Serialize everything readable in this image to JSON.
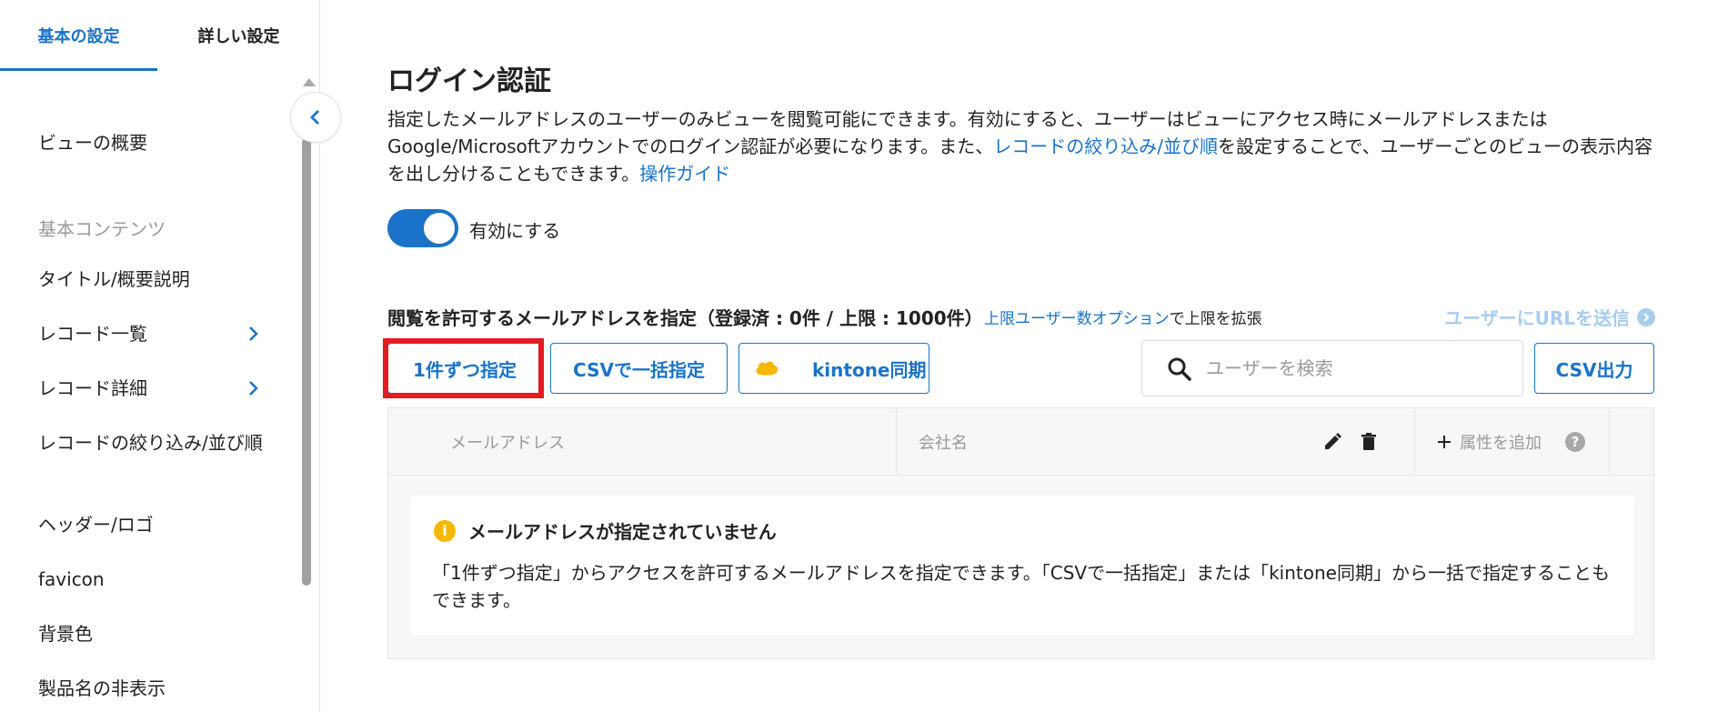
{
  "sidebar": {
    "tabs": [
      {
        "label": "基本の設定",
        "active": true
      },
      {
        "label": "詳しい設定",
        "active": false
      }
    ],
    "items": [
      {
        "label": "ビューの概要"
      },
      {
        "section": "基本コンテンツ"
      },
      {
        "label": "タイトル/概要説明"
      },
      {
        "label": "レコード一覧",
        "has_submenu": true
      },
      {
        "label": "レコード詳細",
        "has_submenu": true
      },
      {
        "label": "レコードの絞り込み/並び順"
      },
      {
        "label": "ヘッダー/ロゴ"
      },
      {
        "label": "favicon"
      },
      {
        "label": "背景色"
      },
      {
        "label": "製品名の非表示"
      }
    ]
  },
  "main": {
    "title": "ログイン認証",
    "description": {
      "part1": "指定したメールアドレスのユーザーのみビューを閲覧可能にできます。有効にすると、ユーザーはビューにアクセス時にメールアドレスまたはGoogle/Microsoftアカウントでのログイン認証が必要になります。また、",
      "link1": "レコードの絞り込み/並び順",
      "part2": "を設定することで、ユーザーごとのビューの表示内容を出し分けることもできます。",
      "link2": "操作ガイド"
    },
    "toggle": {
      "label": "有効にする",
      "enabled": true
    },
    "allowlist": {
      "label": "閲覧を許可するメールアドレスを指定（登録済 : 0件 / 上限 : 1000件）",
      "option_link": "上限ユーザー数オプション",
      "option_suffix": "で上限を拡張",
      "send_url": "ユーザーにURLを送信"
    },
    "buttons": {
      "single": "1件ずつ指定",
      "csv_bulk": "CSVで一括指定",
      "kintone": "kintone同期",
      "export": "CSV出力"
    },
    "search": {
      "placeholder": "ユーザーを検索"
    },
    "table": {
      "columns": [
        "メールアドレス",
        "会社名"
      ],
      "add_attribute": "属性を追加"
    },
    "empty": {
      "title": "メールアドレスが指定されていません",
      "text": "「1件ずつ指定」からアクセスを許可するメールアドレスを指定できます。「CSVで一括指定」または「kintone同期」から一括で指定することもできます。"
    }
  },
  "colors": {
    "accent": "#1a73c9",
    "highlight": "#e31b23",
    "warning": "#f6b700",
    "kintone": "#f6b700"
  }
}
